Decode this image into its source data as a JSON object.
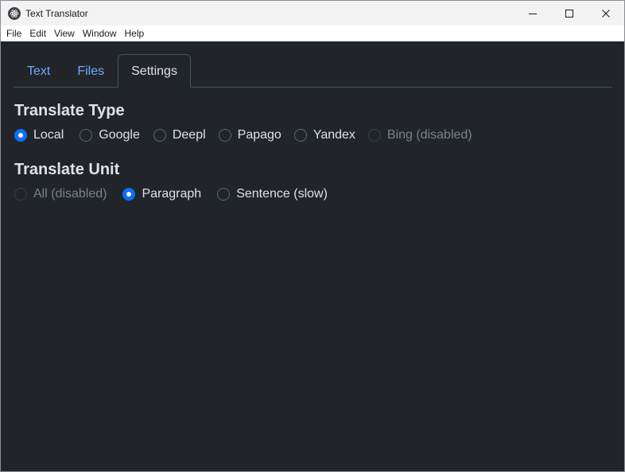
{
  "window": {
    "title": "Text Translator"
  },
  "menu": [
    "File",
    "Edit",
    "View",
    "Window",
    "Help"
  ],
  "tabs": [
    {
      "label": "Text",
      "active": false
    },
    {
      "label": "Files",
      "active": false
    },
    {
      "label": "Settings",
      "active": true
    }
  ],
  "translate_type": {
    "title": "Translate Type",
    "options": [
      {
        "label": "Local",
        "checked": true,
        "disabled": false
      },
      {
        "label": "Google",
        "checked": false,
        "disabled": false
      },
      {
        "label": "Deepl",
        "checked": false,
        "disabled": false
      },
      {
        "label": "Papago",
        "checked": false,
        "disabled": false
      },
      {
        "label": "Yandex",
        "checked": false,
        "disabled": false
      },
      {
        "label": "Bing (disabled)",
        "checked": false,
        "disabled": true
      }
    ]
  },
  "translate_unit": {
    "title": "Translate Unit",
    "options": [
      {
        "label": "All (disabled)",
        "checked": false,
        "disabled": true
      },
      {
        "label": "Paragraph",
        "checked": true,
        "disabled": false
      },
      {
        "label": "Sentence (slow)",
        "checked": false,
        "disabled": false
      }
    ]
  },
  "colors": {
    "background": "#212529",
    "accent": "#0d6efd",
    "tab_link": "#6ea8fe",
    "text": "#dee2e6"
  },
  "icons": {
    "app": "electron-atom-icon",
    "minimize": "minimize-icon",
    "maximize": "maximize-icon",
    "close": "close-icon"
  }
}
